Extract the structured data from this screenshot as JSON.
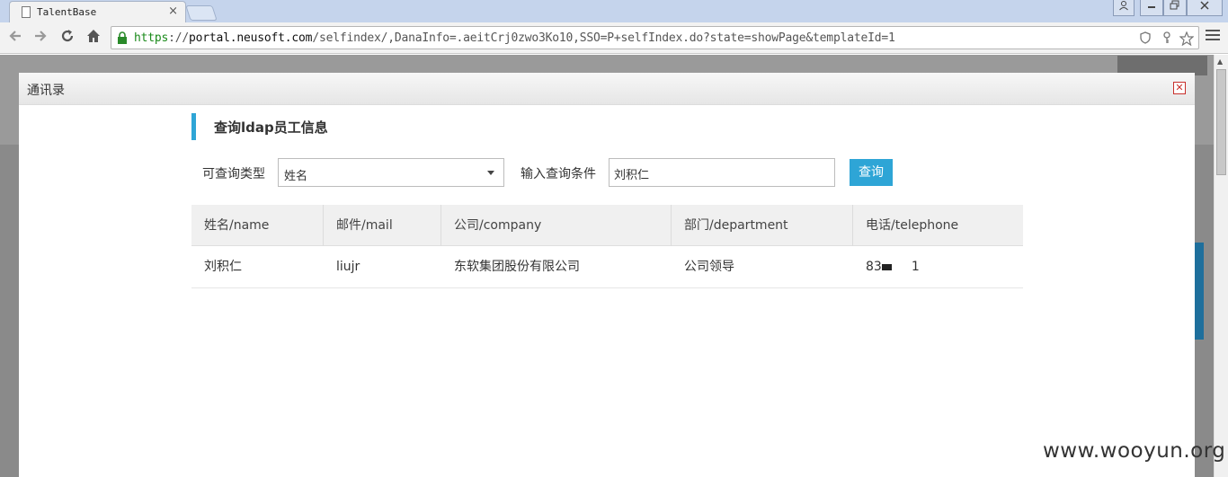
{
  "browser": {
    "tab_title": "TalentBase",
    "tab_close": "×",
    "url_scheme": "https",
    "url_sep": "://",
    "url_host": "portal.neusoft.com",
    "url_path": "/selfindex/,DanaInfo=.aeitCrj0zwo3Ko10,SSO=P+selfIndex.do?state=showPage&templateId=1"
  },
  "modal": {
    "title": "通讯录",
    "section_title": "查询ldap员工信息",
    "type_label": "可查询类型",
    "type_value": "姓名",
    "cond_label": "输入查询条件",
    "cond_value": "刘积仁",
    "query_button": "查询"
  },
  "table": {
    "headers": [
      "姓名/name",
      "邮件/mail",
      "公司/company",
      "部门/department",
      "电话/telephone"
    ],
    "rows": [
      {
        "name": "刘积仁",
        "mail": "liujr",
        "company": "东软集团股份有限公司",
        "department": "公司领导",
        "phone_a": "83",
        "phone_b": "1"
      }
    ]
  },
  "watermark": "www.wooyun.org"
}
